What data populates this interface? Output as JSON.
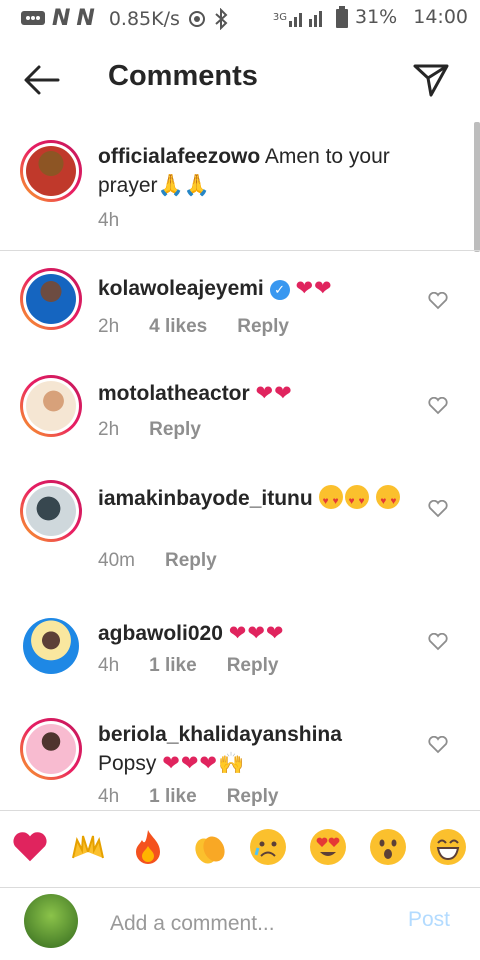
{
  "status": {
    "speed": "0.85K/s",
    "network": "3G",
    "battery": "31%",
    "time": "14:00"
  },
  "header": {
    "title": "Comments"
  },
  "caption": {
    "username": "officialafeezowo",
    "text": "Amen to your prayer",
    "emoji": "🙏🙏",
    "time": "4h"
  },
  "comments": [
    {
      "username": "kolawoleajeyemi",
      "verified": true,
      "text": "",
      "hearts": "❤❤",
      "time": "2h",
      "likes": "4 likes",
      "reply": "Reply"
    },
    {
      "username": "motolatheactor",
      "text": "",
      "hearts": "❤❤",
      "time": "2h",
      "reply": "Reply"
    },
    {
      "username": "iamakinbayode_itunu",
      "text": "",
      "time": "40m",
      "reply": "Reply"
    },
    {
      "username": "agbawoli020",
      "text": "",
      "hearts": "❤❤❤",
      "time": "4h",
      "likes": "1 like",
      "reply": "Reply"
    },
    {
      "username": "beriola_khalidayanshina",
      "text": "Popsy",
      "hearts": "❤❤❤",
      "emoji": "🙌",
      "time": "4h",
      "likes": "1 like",
      "reply": "Reply"
    }
  ],
  "emoji_bar": [
    "heart",
    "raised-hands",
    "fire",
    "clapping-hands",
    "crying-face",
    "heart-eyes-face",
    "surprised-face",
    "laughing-face"
  ],
  "input": {
    "placeholder": "Add a comment...",
    "post_label": "Post"
  },
  "colors": {
    "heart": "#e0245e",
    "verified": "#3897f0",
    "post_disabled": "#b3dbff"
  }
}
